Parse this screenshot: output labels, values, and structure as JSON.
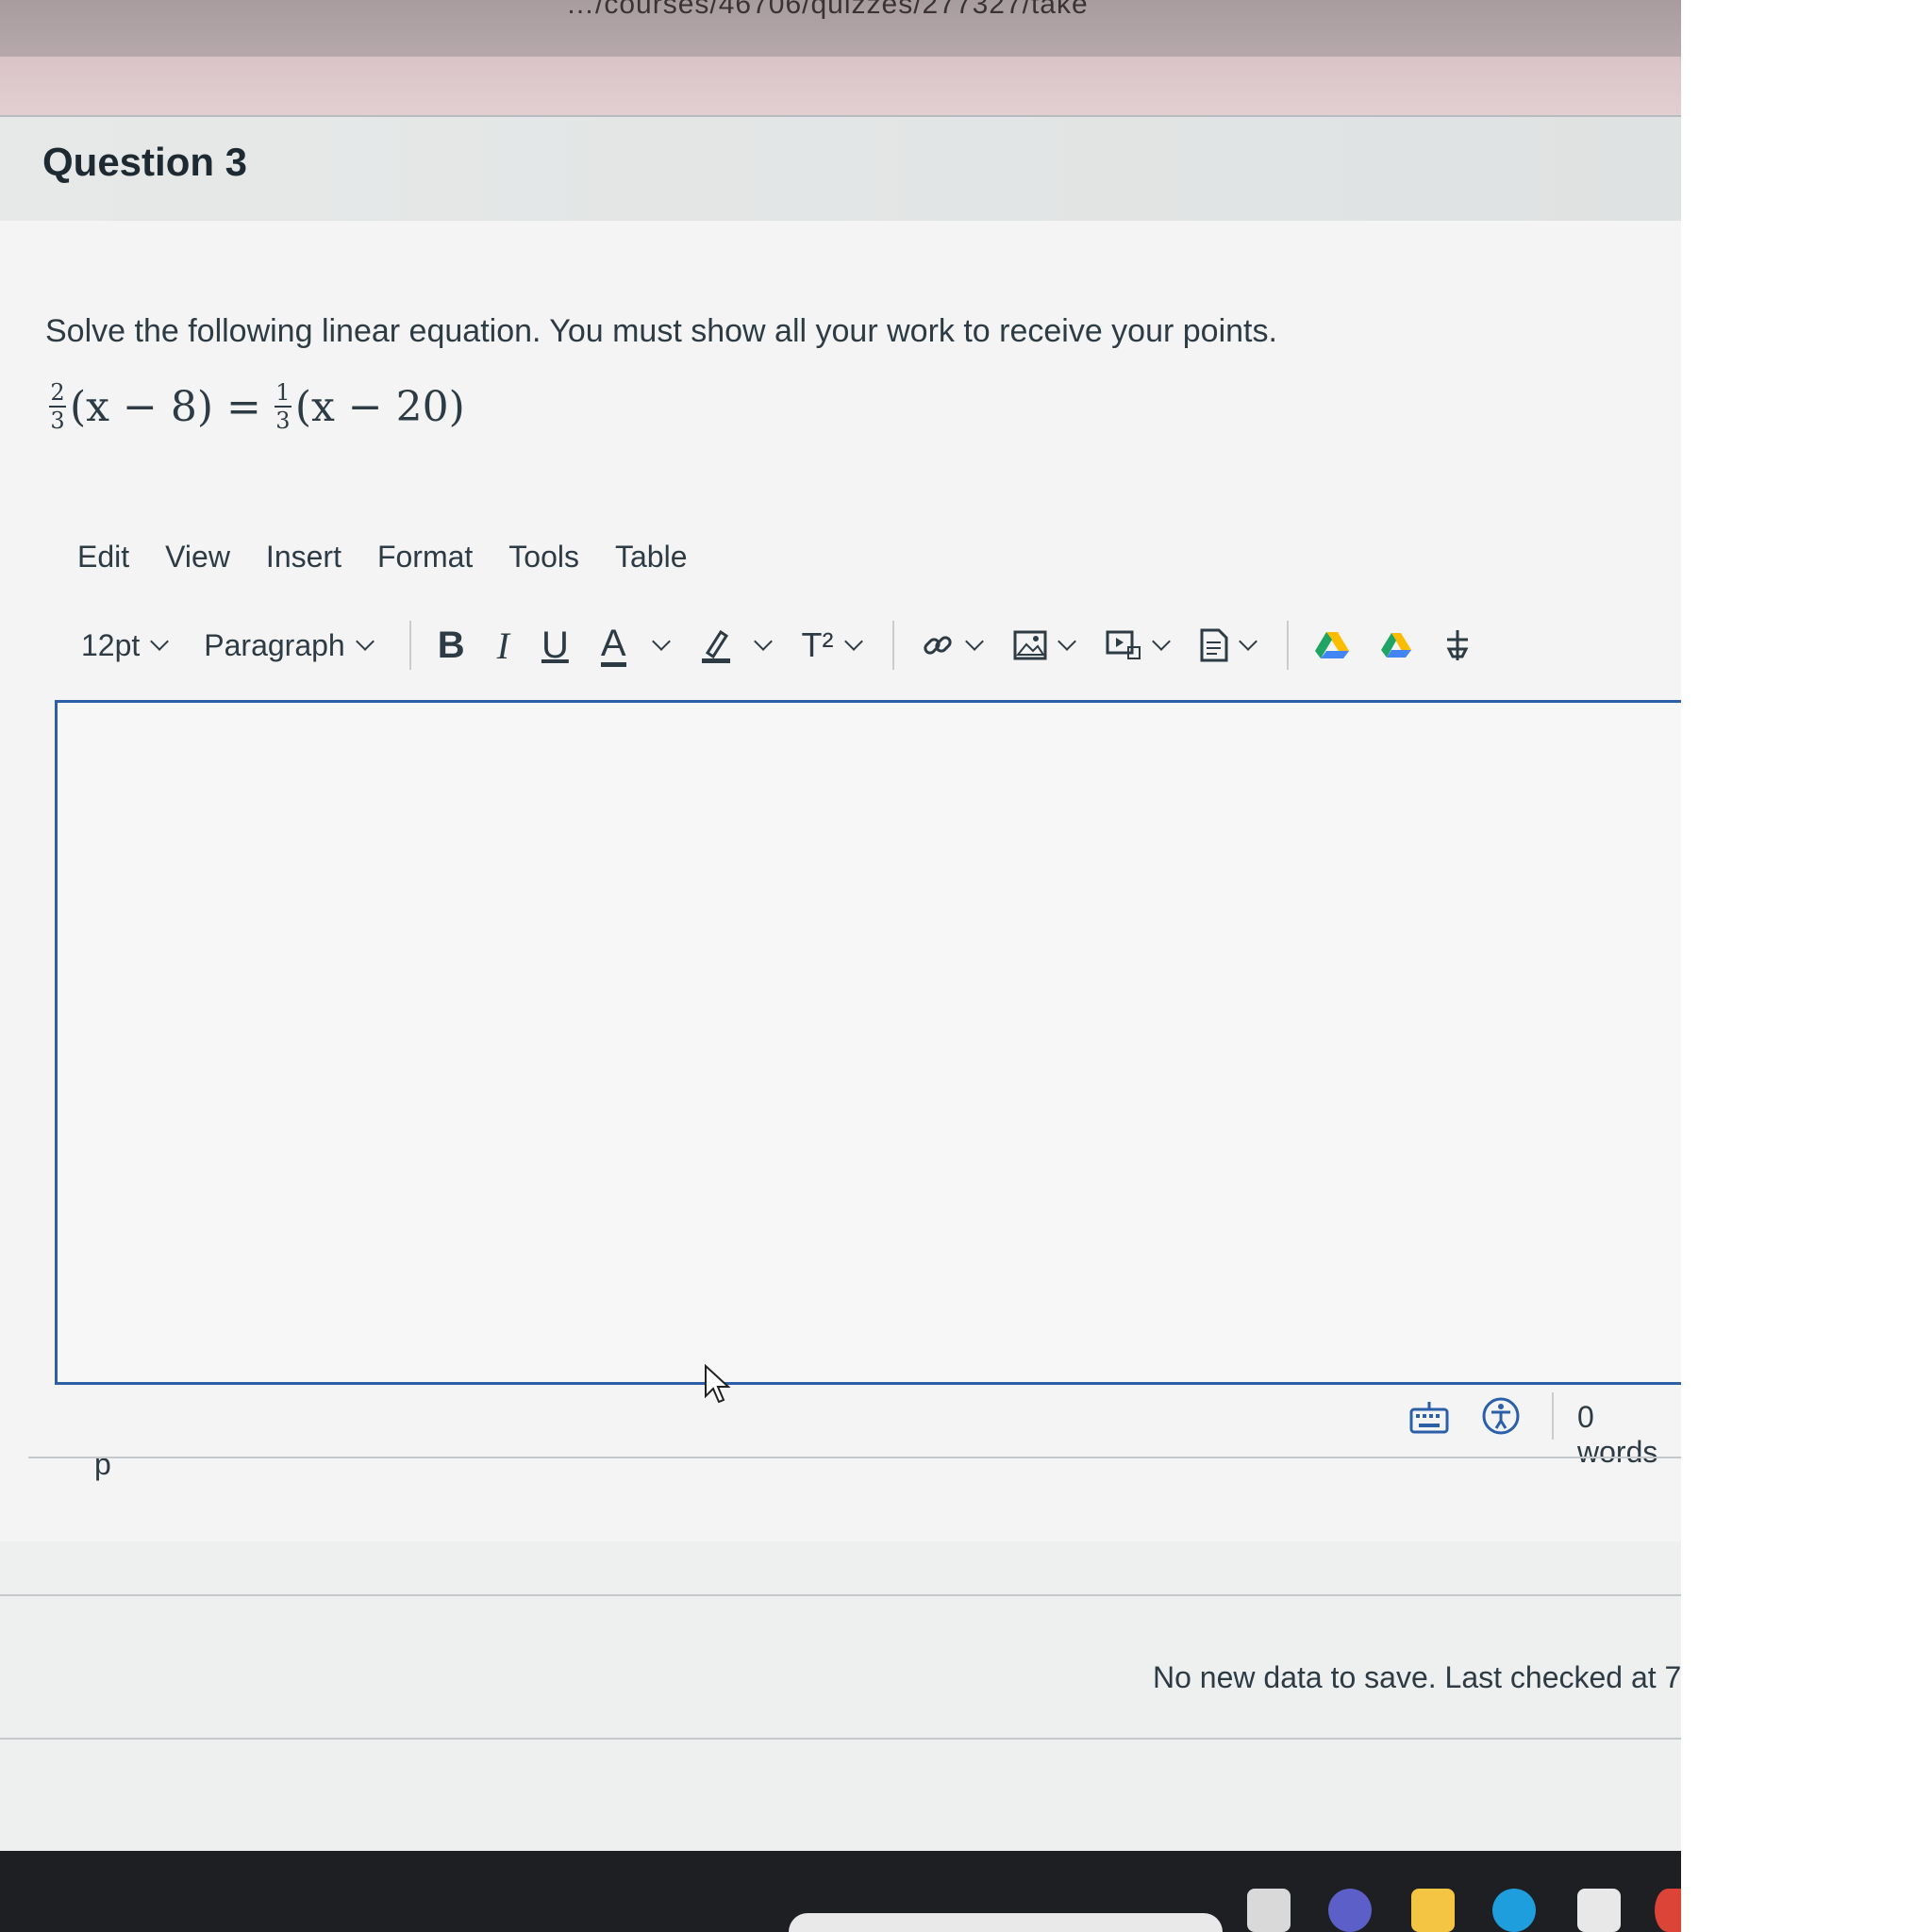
{
  "browser": {
    "url_fragment": "…/courses/46706/quizzes/277327/take"
  },
  "question": {
    "title": "Question 3",
    "prompt": "Solve the following linear equation. You must show all your work to receive your points.",
    "equation": {
      "lhs_num": "2",
      "lhs_den": "3",
      "lhs_expr": "(x − 8) =",
      "rhs_num": "1",
      "rhs_den": "3",
      "rhs_expr": "(x − 20)"
    }
  },
  "editor": {
    "menu": [
      "Edit",
      "View",
      "Insert",
      "Format",
      "Tools",
      "Table"
    ],
    "font_size": "12pt",
    "block_format": "Paragraph",
    "buttons": {
      "bold": "B",
      "italic": "I",
      "underline": "U",
      "text_color": "A",
      "superscript": "T²"
    },
    "icons": [
      "link-icon",
      "image-icon",
      "media-icon",
      "document-icon",
      "google-drive-icon",
      "google-drive-icon-2",
      "apps-icon"
    ],
    "content": "",
    "path": "p",
    "word_count": "0 words"
  },
  "save_status": "No new data to save. Last checked at 7",
  "colors": {
    "accent": "#2b5fa8",
    "text": "#2d3b45",
    "background": "#eef0ef"
  }
}
